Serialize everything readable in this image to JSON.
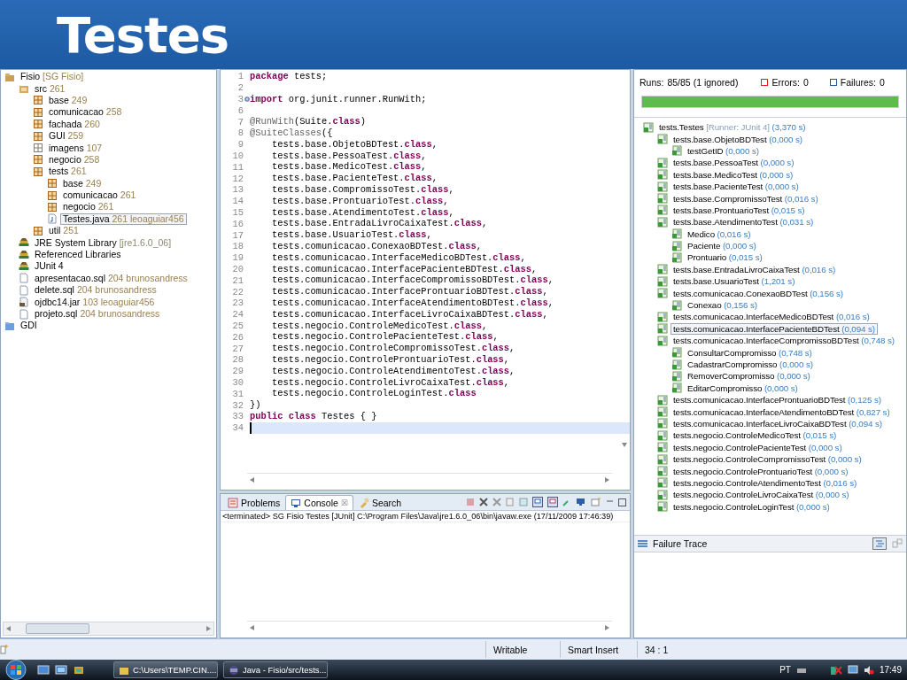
{
  "slide_title": "Testes",
  "package_explorer": {
    "items": [
      {
        "kind": "project",
        "name": "Fisio",
        "decoration": "[SG Fisio]",
        "selected": false,
        "children": [
          {
            "kind": "source-folder",
            "name": "src",
            "decoration": "261",
            "selected": false,
            "children": [
              {
                "kind": "package",
                "name": "base",
                "decoration": "249",
                "selected": false
              },
              {
                "kind": "package",
                "name": "comunicacao",
                "decoration": "258",
                "selected": false
              },
              {
                "kind": "package",
                "name": "fachada",
                "decoration": "260",
                "selected": false
              },
              {
                "kind": "package",
                "name": "GUI",
                "decoration": "259",
                "selected": false
              },
              {
                "kind": "empty-package",
                "name": "imagens",
                "decoration": "107",
                "selected": false
              },
              {
                "kind": "package",
                "name": "negocio",
                "decoration": "258",
                "selected": false
              },
              {
                "kind": "package",
                "name": "tests",
                "decoration": "261",
                "selected": false,
                "children": [
                  {
                    "kind": "package",
                    "name": "base",
                    "decoration": "249",
                    "selected": false
                  },
                  {
                    "kind": "package",
                    "name": "comunicacao",
                    "decoration": "261",
                    "selected": false
                  },
                  {
                    "kind": "package",
                    "name": "negocio",
                    "decoration": "261",
                    "selected": false
                  },
                  {
                    "kind": "java-file",
                    "name": "Testes.java",
                    "decoration": "261 leoaguiar456",
                    "selected": true
                  }
                ]
              },
              {
                "kind": "package",
                "name": "util",
                "decoration": "251",
                "selected": false
              }
            ]
          },
          {
            "kind": "library",
            "name": "JRE System Library",
            "decoration": "[jre1.6.0_06]",
            "selected": false
          },
          {
            "kind": "library",
            "name": "Referenced Libraries",
            "selected": false
          },
          {
            "kind": "library",
            "name": "JUnit 4",
            "selected": false
          },
          {
            "kind": "file",
            "name": "apresentacao.sql",
            "decoration": "204 brunosandress",
            "selected": false
          },
          {
            "kind": "file",
            "name": "delete.sql",
            "decoration": "204 brunosandress",
            "selected": false
          },
          {
            "kind": "jar",
            "name": "ojdbc14.jar",
            "decoration": "103 leoaguiar456",
            "selected": false
          },
          {
            "kind": "file",
            "name": "projeto.sql",
            "decoration": "204 brunosandress",
            "selected": false
          }
        ]
      },
      {
        "kind": "folder",
        "name": "GDI",
        "selected": false
      }
    ]
  },
  "editor": {
    "lines": [
      {
        "number": "1",
        "current": false,
        "folded": false,
        "tokens": [
          {
            "kind": "keyword",
            "text": "package"
          },
          {
            "kind": "plain",
            "text": " tests;"
          }
        ]
      },
      {
        "number": "2",
        "current": false,
        "folded": false
      },
      {
        "number": "3",
        "current": false,
        "folded": true,
        "tokens": [
          {
            "kind": "keyword",
            "text": "import"
          },
          {
            "kind": "plain",
            "text": " org.junit.runner.RunWith;"
          }
        ]
      },
      {
        "number": "6",
        "current": false,
        "folded": false
      },
      {
        "number": "7",
        "current": false,
        "folded": false,
        "tokens": [
          {
            "kind": "annotation",
            "text": "@RunWith"
          },
          {
            "kind": "plain",
            "text": "(Suite."
          },
          {
            "kind": "keyword",
            "text": "class"
          },
          {
            "kind": "plain",
            "text": ")"
          }
        ]
      },
      {
        "number": "8",
        "current": false,
        "folded": false,
        "tokens": [
          {
            "kind": "annotation",
            "text": "@SuiteClasses"
          },
          {
            "kind": "plain",
            "text": "({"
          }
        ]
      },
      {
        "number": "9",
        "current": false,
        "folded": false,
        "tokens": [
          {
            "kind": "plain",
            "text": "    tests.base.ObjetoBDTest."
          },
          {
            "kind": "keyword",
            "text": "class"
          },
          {
            "kind": "plain",
            "text": ","
          }
        ]
      },
      {
        "number": "10",
        "current": false,
        "folded": false,
        "tokens": [
          {
            "kind": "plain",
            "text": "    tests.base.PessoaTest."
          },
          {
            "kind": "keyword",
            "text": "class"
          },
          {
            "kind": "plain",
            "text": ","
          }
        ]
      },
      {
        "number": "11",
        "current": false,
        "folded": false,
        "tokens": [
          {
            "kind": "plain",
            "text": "    tests.base.MedicoTest."
          },
          {
            "kind": "keyword",
            "text": "class"
          },
          {
            "kind": "plain",
            "text": ","
          }
        ]
      },
      {
        "number": "12",
        "current": false,
        "folded": false,
        "tokens": [
          {
            "kind": "plain",
            "text": "    tests.base.PacienteTest."
          },
          {
            "kind": "keyword",
            "text": "class"
          },
          {
            "kind": "plain",
            "text": ","
          }
        ]
      },
      {
        "number": "13",
        "current": false,
        "folded": false,
        "tokens": [
          {
            "kind": "plain",
            "text": "    tests.base.CompromissoTest."
          },
          {
            "kind": "keyword",
            "text": "class"
          },
          {
            "kind": "plain",
            "text": ","
          }
        ]
      },
      {
        "number": "14",
        "current": false,
        "folded": false,
        "tokens": [
          {
            "kind": "plain",
            "text": "    tests.base.ProntuarioTest."
          },
          {
            "kind": "keyword",
            "text": "class"
          },
          {
            "kind": "plain",
            "text": ","
          }
        ]
      },
      {
        "number": "15",
        "current": false,
        "folded": false,
        "tokens": [
          {
            "kind": "plain",
            "text": "    tests.base.AtendimentoTest."
          },
          {
            "kind": "keyword",
            "text": "class"
          },
          {
            "kind": "plain",
            "text": ","
          }
        ]
      },
      {
        "number": "16",
        "current": false,
        "folded": false,
        "tokens": [
          {
            "kind": "plain",
            "text": "    tests.base.EntradaLivroCaixaTest."
          },
          {
            "kind": "keyword",
            "text": "class"
          },
          {
            "kind": "plain",
            "text": ","
          }
        ]
      },
      {
        "number": "17",
        "current": false,
        "folded": false,
        "tokens": [
          {
            "kind": "plain",
            "text": "    tests.base.UsuarioTest."
          },
          {
            "kind": "keyword",
            "text": "class"
          },
          {
            "kind": "plain",
            "text": ","
          }
        ]
      },
      {
        "number": "18",
        "current": false,
        "folded": false,
        "tokens": [
          {
            "kind": "plain",
            "text": "    tests.comunicacao.ConexaoBDTest."
          },
          {
            "kind": "keyword",
            "text": "class"
          },
          {
            "kind": "plain",
            "text": ","
          }
        ]
      },
      {
        "number": "19",
        "current": false,
        "folded": false,
        "tokens": [
          {
            "kind": "plain",
            "text": "    tests.comunicacao.InterfaceMedicoBDTest."
          },
          {
            "kind": "keyword",
            "text": "class"
          },
          {
            "kind": "plain",
            "text": ","
          }
        ]
      },
      {
        "number": "20",
        "current": false,
        "folded": false,
        "tokens": [
          {
            "kind": "plain",
            "text": "    tests.comunicacao.InterfacePacienteBDTest."
          },
          {
            "kind": "keyword",
            "text": "class"
          },
          {
            "kind": "plain",
            "text": ","
          }
        ]
      },
      {
        "number": "21",
        "current": false,
        "folded": false,
        "tokens": [
          {
            "kind": "plain",
            "text": "    tests.comunicacao.InterfaceCompromissoBDTest."
          },
          {
            "kind": "keyword",
            "text": "class"
          },
          {
            "kind": "plain",
            "text": ","
          }
        ]
      },
      {
        "number": "22",
        "current": false,
        "folded": false,
        "tokens": [
          {
            "kind": "plain",
            "text": "    tests.comunicacao.InterfaceProntuarioBDTest."
          },
          {
            "kind": "keyword",
            "text": "class"
          },
          {
            "kind": "plain",
            "text": ","
          }
        ]
      },
      {
        "number": "23",
        "current": false,
        "folded": false,
        "tokens": [
          {
            "kind": "plain",
            "text": "    tests.comunicacao.InterfaceAtendimentoBDTest."
          },
          {
            "kind": "keyword",
            "text": "class"
          },
          {
            "kind": "plain",
            "text": ","
          }
        ]
      },
      {
        "number": "24",
        "current": false,
        "folded": false,
        "tokens": [
          {
            "kind": "plain",
            "text": "    tests.comunicacao.InterfaceLivroCaixaBDTest."
          },
          {
            "kind": "keyword",
            "text": "class"
          },
          {
            "kind": "plain",
            "text": ","
          }
        ]
      },
      {
        "number": "25",
        "current": false,
        "folded": false,
        "tokens": [
          {
            "kind": "plain",
            "text": "    tests.negocio.ControleMedicoTest."
          },
          {
            "kind": "keyword",
            "text": "class"
          },
          {
            "kind": "plain",
            "text": ","
          }
        ]
      },
      {
        "number": "26",
        "current": false,
        "folded": false,
        "tokens": [
          {
            "kind": "plain",
            "text": "    tests.negocio.ControlePacienteTest."
          },
          {
            "kind": "keyword",
            "text": "class"
          },
          {
            "kind": "plain",
            "text": ","
          }
        ]
      },
      {
        "number": "27",
        "current": false,
        "folded": false,
        "tokens": [
          {
            "kind": "plain",
            "text": "    tests.negocio.ControleCompromissoTest."
          },
          {
            "kind": "keyword",
            "text": "class"
          },
          {
            "kind": "plain",
            "text": ","
          }
        ]
      },
      {
        "number": "28",
        "current": false,
        "folded": false,
        "tokens": [
          {
            "kind": "plain",
            "text": "    tests.negocio.ControleProntuarioTest."
          },
          {
            "kind": "keyword",
            "text": "class"
          },
          {
            "kind": "plain",
            "text": ","
          }
        ]
      },
      {
        "number": "29",
        "current": false,
        "folded": false,
        "tokens": [
          {
            "kind": "plain",
            "text": "    tests.negocio.ControleAtendimentoTest."
          },
          {
            "kind": "keyword",
            "text": "class"
          },
          {
            "kind": "plain",
            "text": ","
          }
        ]
      },
      {
        "number": "30",
        "current": false,
        "folded": false,
        "tokens": [
          {
            "kind": "plain",
            "text": "    tests.negocio.ControleLivroCaixaTest."
          },
          {
            "kind": "keyword",
            "text": "class"
          },
          {
            "kind": "plain",
            "text": ","
          }
        ]
      },
      {
        "number": "31",
        "current": false,
        "folded": false,
        "tokens": [
          {
            "kind": "plain",
            "text": "    tests.negocio.ControleLoginTest."
          },
          {
            "kind": "keyword",
            "text": "class"
          }
        ]
      },
      {
        "number": "32",
        "current": false,
        "folded": false,
        "tokens": [
          {
            "kind": "plain",
            "text": "})"
          }
        ]
      },
      {
        "number": "33",
        "current": false,
        "folded": false,
        "tokens": [
          {
            "kind": "keyword",
            "text": "public class"
          },
          {
            "kind": "plain",
            "text": " Testes { }"
          }
        ]
      },
      {
        "number": "34",
        "current": true,
        "folded": false
      }
    ]
  },
  "console": {
    "tabs": [
      {
        "label": "Problems",
        "selected": false,
        "closable": false,
        "kind": "problems"
      },
      {
        "label": "Console",
        "selected": true,
        "closable": true,
        "kind": "console"
      },
      {
        "label": "Search",
        "selected": false,
        "closable": false,
        "kind": "search"
      }
    ],
    "close_glyph": "☒",
    "output": "<terminated> SG Fisio Testes [JUnit] C:\\Program Files\\Java\\jre1.6.0_06\\bin\\javaw.exe (17/11/2009 17:46:39)"
  },
  "junit": {
    "runs_label": "Runs:",
    "runs": "85/85 (1 ignored)",
    "errors_label": "Errors:",
    "errors": "0",
    "failures_label": "Failures:",
    "failures": "0",
    "progress": {
      "level": 1
    },
    "items": [
      {
        "kind": "suite",
        "name": "tests.Testes",
        "runner": "[Runner: JUnit 4]",
        "time": "(3,370 s)",
        "selected": false,
        "children": [
          {
            "kind": "suite",
            "name": "tests.base.ObjetoBDTest",
            "time": "(0,000 s)",
            "selected": false,
            "children": [
              {
                "kind": "test",
                "name": "testGetID",
                "time": "(0,000 s)",
                "selected": false
              }
            ]
          },
          {
            "kind": "suite",
            "name": "tests.base.PessoaTest",
            "time": "(0,000 s)",
            "selected": false
          },
          {
            "kind": "suite",
            "name": "tests.base.MedicoTest",
            "time": "(0,000 s)",
            "selected": false
          },
          {
            "kind": "suite",
            "name": "tests.base.PacienteTest",
            "time": "(0,000 s)",
            "selected": false
          },
          {
            "kind": "suite",
            "name": "tests.base.CompromissoTest",
            "time": "(0,016 s)",
            "selected": false
          },
          {
            "kind": "suite",
            "name": "tests.base.ProntuarioTest",
            "time": "(0,015 s)",
            "selected": false
          },
          {
            "kind": "suite",
            "name": "tests.base.AtendimentoTest",
            "time": "(0,031 s)",
            "selected": false,
            "children": [
              {
                "kind": "test",
                "name": "Medico",
                "time": "(0,016 s)",
                "selected": false
              },
              {
                "kind": "test",
                "name": "Paciente",
                "time": "(0,000 s)",
                "selected": false
              },
              {
                "kind": "test",
                "name": "Prontuario",
                "time": "(0,015 s)",
                "selected": false
              }
            ]
          },
          {
            "kind": "suite",
            "name": "tests.base.EntradaLivroCaixaTest",
            "time": "(0,016 s)",
            "selected": false
          },
          {
            "kind": "suite",
            "name": "tests.base.UsuarioTest",
            "time": "(1,201 s)",
            "selected": false
          },
          {
            "kind": "suite",
            "name": "tests.comunicacao.ConexaoBDTest",
            "time": "(0,156 s)",
            "selected": false,
            "children": [
              {
                "kind": "test",
                "name": "Conexao",
                "time": "(0,156 s)",
                "selected": false
              }
            ]
          },
          {
            "kind": "suite",
            "name": "tests.comunicacao.InterfaceMedicoBDTest",
            "time": "(0,016 s)",
            "selected": false
          },
          {
            "kind": "suite",
            "name": "tests.comunicacao.InterfacePacienteBDTest",
            "time": "(0,094 s)",
            "selected": true
          },
          {
            "kind": "suite",
            "name": "tests.comunicacao.InterfaceCompromissoBDTest",
            "time": "(0,748 s)",
            "selected": false,
            "children": [
              {
                "kind": "test",
                "name": "ConsultarCompromisso",
                "time": "(0,748 s)",
                "selected": false
              },
              {
                "kind": "test",
                "name": "CadastrarCompromisso",
                "time": "(0,000 s)",
                "selected": false
              },
              {
                "kind": "test",
                "name": "RemoverCompromisso",
                "time": "(0,000 s)",
                "selected": false
              },
              {
                "kind": "test",
                "name": "EditarCompromisso",
                "time": "(0,000 s)",
                "selected": false
              }
            ]
          },
          {
            "kind": "suite",
            "name": "tests.comunicacao.InterfaceProntuarioBDTest",
            "time": "(0,125 s)",
            "selected": false
          },
          {
            "kind": "suite",
            "name": "tests.comunicacao.InterfaceAtendimentoBDTest",
            "time": "(0,827 s)",
            "selected": false
          },
          {
            "kind": "suite",
            "name": "tests.comunicacao.InterfaceLivroCaixaBDTest",
            "time": "(0,094 s)",
            "selected": false
          },
          {
            "kind": "suite",
            "name": "tests.negocio.ControleMedicoTest",
            "time": "(0,015 s)",
            "selected": false
          },
          {
            "kind": "suite",
            "name": "tests.negocio.ControlePacienteTest",
            "time": "(0,000 s)",
            "selected": false
          },
          {
            "kind": "suite",
            "name": "tests.negocio.ControleCompromissoTest",
            "time": "(0,000 s)",
            "selected": false
          },
          {
            "kind": "suite",
            "name": "tests.negocio.ControleProntuarioTest",
            "time": "(0,000 s)",
            "selected": false
          },
          {
            "kind": "suite",
            "name": "tests.negocio.ControleAtendimentoTest",
            "time": "(0,016 s)",
            "selected": false
          },
          {
            "kind": "suite",
            "name": "tests.negocio.ControleLivroCaixaTest",
            "time": "(0,000 s)",
            "selected": false
          },
          {
            "kind": "suite",
            "name": "tests.negocio.ControleLoginTest",
            "time": "(0,000 s)",
            "selected": false
          }
        ]
      }
    ],
    "failure_trace": "Failure Trace"
  },
  "status_bar": [
    "Writable",
    "Smart Insert",
    "34 : 1"
  ],
  "taskbar": {
    "tasks": [
      {
        "kind": "folder",
        "label": "C:\\Users\\TEMP.CIN....",
        "selected": false
      },
      {
        "kind": "eclipse",
        "label": "Java - Fisio/src/tests...",
        "selected": true
      }
    ],
    "language": "PT",
    "clock": "17:49"
  }
}
